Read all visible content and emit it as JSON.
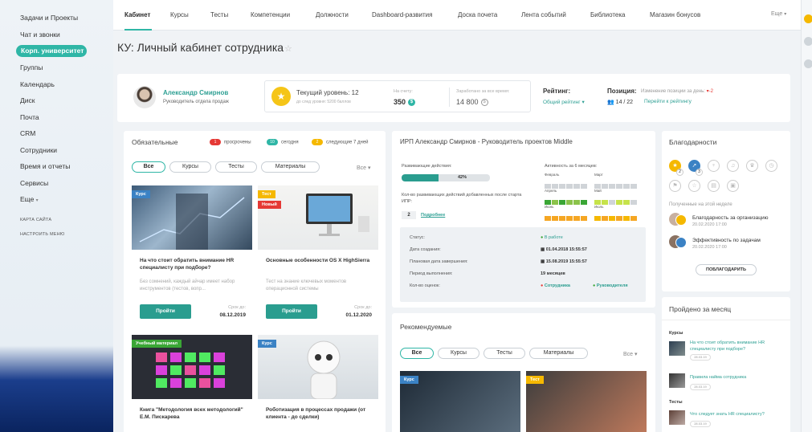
{
  "sidebar": {
    "items": [
      "Задачи и Проекты",
      "Чат и звонки",
      "Корп. университет",
      "Группы",
      "Календарь",
      "Диск",
      "Почта",
      "CRM",
      "Сотрудники",
      "Время и отчеты",
      "Сервисы",
      "Еще"
    ],
    "active_index": 2,
    "small_links": [
      "КАРТА САЙТА",
      "НАСТРОИТЬ МЕНЮ"
    ]
  },
  "topnav": {
    "items": [
      "Кабинет",
      "Курсы",
      "Тесты",
      "Компетенции",
      "Должности",
      "Dashboard-развития",
      "Доска почета",
      "Лента событий",
      "Библиотека",
      "Магазин бонусов"
    ],
    "more": "Еще"
  },
  "page_title": "КУ: Личный кабинет сотрудника",
  "profile": {
    "name": "Александр Смирнов",
    "role": "Руководитель отдела продаж",
    "level_title": "Текущий уровень: 12",
    "level_sub": "до след уровня: 5200 баллов",
    "balance_label": "На счету:",
    "balance_value": "350",
    "earned_label": "Заработано за все время:",
    "earned_value": "14 800",
    "rating_label": "Рейтинг:",
    "rating_link": "Общий рейтинг",
    "position_label": "Позиция:",
    "position_value": "14 / 22",
    "change_label": "Изменение позиции за день:",
    "change_value": "-2",
    "rating_goto": "Перейти к рейтингу"
  },
  "mandatory": {
    "title": "Обязательные",
    "legend": [
      {
        "count": "1",
        "label": "просрочены",
        "color": "#e53935"
      },
      {
        "count": "10",
        "label": "сегодня",
        "color": "#2fb6a6"
      },
      {
        "count": "2",
        "label": "следующие 7 дней",
        "color": "#f5b800"
      }
    ],
    "filters": [
      "Все",
      "Курсы",
      "Тесты",
      "Материалы"
    ],
    "all_dropdown": "Все",
    "tiles": [
      {
        "tag": "Курс",
        "tag2": "",
        "title": "На что стоит обратить внимание HR специалисту при подборе?",
        "desc": "Без сомнений, каждый айчар имеет набор инструментов (тестов, вопр...",
        "button": "Пройти",
        "due_label": "Срок до:",
        "due": "08.12.2019"
      },
      {
        "tag": "Тест",
        "tag2": "Новый",
        "title": "Основные особенности OS X HighSierra",
        "desc": "Тест на знание ключевых моментов операционной системы",
        "button": "Пройти",
        "due_label": "Срок до:",
        "due": "01.12.2020"
      },
      {
        "tag": "Учебный материал",
        "tag2": "",
        "title": "Книга \"Методология всех методологий\" Е.М. Пискарева",
        "desc": "",
        "button": "",
        "due_label": "",
        "due": ""
      },
      {
        "tag": "Курс",
        "tag2": "",
        "title": "Роботизация в процессах продажи (от клиента - до сделки)",
        "desc": "",
        "button": "",
        "due_label": "",
        "due": ""
      }
    ]
  },
  "ipr": {
    "title": "ИРП Александр Смирнов - Руководитель проектов Middle",
    "dev_actions_label": "Развивающие действия:",
    "progress": 42,
    "progress_text": "42%",
    "added_label": "Кол-во развивающих действий добавленных после старта ИПР:",
    "added_count": "2",
    "added_link": "Подробнее",
    "activity_label": "Активность за 6 месяцев:",
    "months": [
      "Февраль",
      "Март",
      "Апрель",
      "Май",
      "Июнь",
      "Июль"
    ],
    "fields": [
      {
        "label": "Статус:",
        "value": "В работе"
      },
      {
        "label": "Дата создания:",
        "value": "01.04.2018 15:55:57"
      },
      {
        "label": "Плановая дата завершения:",
        "value": "15.08.2019 15:55:57"
      },
      {
        "label": "Период выполнения:",
        "value": "19 месяцев"
      },
      {
        "label": "Кол-во оценок:",
        "value": "Сотрудника",
        "value2": "Руководителя"
      }
    ]
  },
  "recommended": {
    "title": "Рекомендуемые",
    "filters": [
      "Все",
      "Курсы",
      "Тесты",
      "Материалы"
    ],
    "all_dropdown": "Все",
    "tags": [
      "Курс",
      "Тест"
    ]
  },
  "thanks": {
    "title": "Благодарности",
    "week_label": "Полученные на этой неделе",
    "items": [
      {
        "title": "Благодарность за организацию",
        "date": "20.02.2020 17:00"
      },
      {
        "title": "Эффективность по задачам",
        "date": "20.02.2020 17:00"
      }
    ],
    "button": "ПОБЛАГОДАРИТЬ",
    "badge_counts": [
      "2",
      "3"
    ]
  },
  "passed": {
    "title": "Пройдено за месяц",
    "courses_label": "Курсы",
    "tests_label": "Тесты",
    "items": [
      {
        "title": "На что стоит обратить внимание HR специалисту при подборе?",
        "date": "28.03.19"
      },
      {
        "title": "Правила найма сотрудника",
        "date": "28.03.19"
      },
      {
        "title": "Что следует знать HR специалисту?",
        "date": "28.03.19"
      }
    ]
  }
}
